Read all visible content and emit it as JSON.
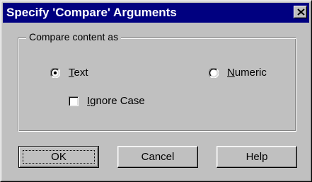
{
  "window": {
    "title": "Specify 'Compare' Arguments",
    "close_glyph": "close-icon"
  },
  "group": {
    "label": "Compare content as"
  },
  "options": {
    "text": {
      "mnemonic": "T",
      "rest": "ext",
      "selected": true
    },
    "numeric": {
      "mnemonic": "N",
      "rest": "umeric",
      "selected": false
    },
    "ignore_case": {
      "mnemonic": "I",
      "rest": "gnore Case",
      "checked": false
    }
  },
  "buttons": {
    "ok": "OK",
    "cancel": "Cancel",
    "help": "Help"
  },
  "colors": {
    "titlebar": "#000080",
    "face": "#c0c0c0"
  }
}
